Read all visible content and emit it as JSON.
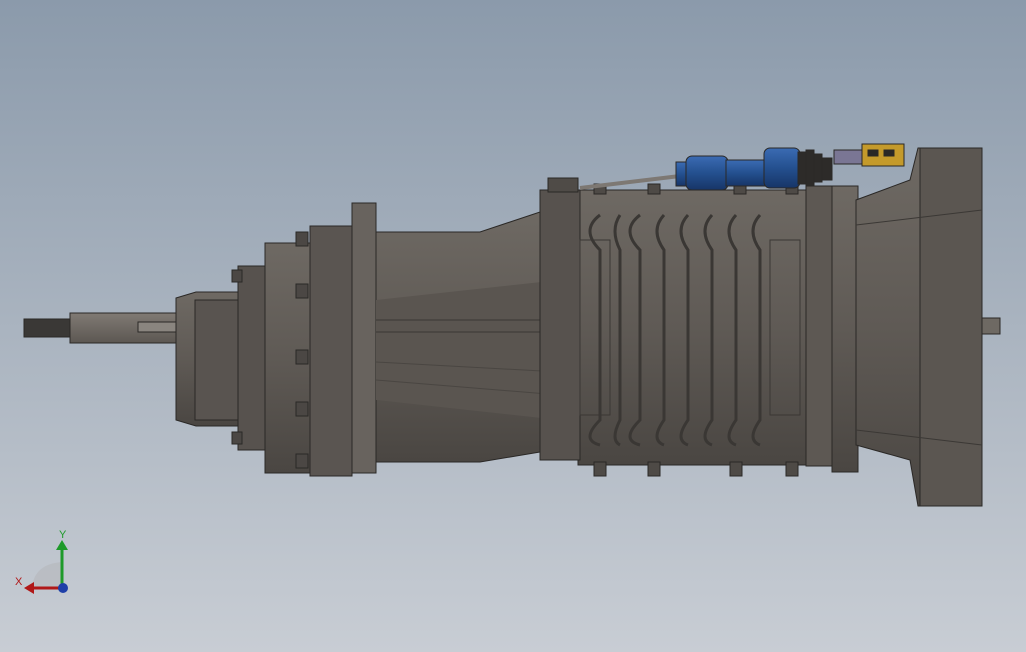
{
  "viewport": {
    "background_top": "#8b9aab",
    "background_bottom": "#c8cdd4"
  },
  "model": {
    "housing_color": "#5f5a55",
    "housing_dark": "#3d3a37",
    "housing_light": "#78736d",
    "actuator_color": "#24508f",
    "sensor_color": "#c49a2b"
  },
  "triad": {
    "x_label": "X",
    "y_label": "Y",
    "x_color": "#b01818",
    "y_color": "#1e9a2a",
    "z_color": "#1e3fa8"
  }
}
